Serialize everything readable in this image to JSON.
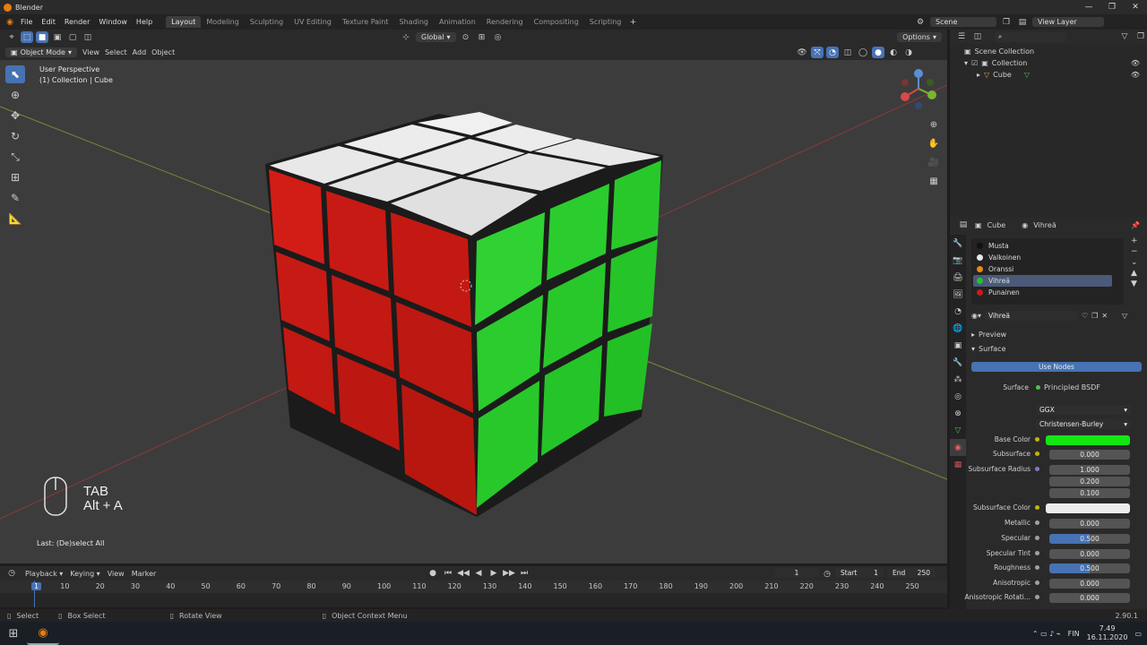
{
  "window": {
    "title": "Blender",
    "controls": [
      "—",
      "❐",
      "✕"
    ]
  },
  "menu": {
    "items": [
      "File",
      "Edit",
      "Render",
      "Window",
      "Help"
    ]
  },
  "workspaces": [
    {
      "label": "Layout",
      "active": true
    },
    {
      "label": "Modeling"
    },
    {
      "label": "Sculpting"
    },
    {
      "label": "UV Editing"
    },
    {
      "label": "Texture Paint"
    },
    {
      "label": "Shading"
    },
    {
      "label": "Animation"
    },
    {
      "label": "Rendering"
    },
    {
      "label": "Compositing"
    },
    {
      "label": "Scripting"
    }
  ],
  "scene": {
    "name": "Scene",
    "view_layer": "View Layer"
  },
  "viewport_toolbar": {
    "orientation": "Global",
    "options": "Options"
  },
  "viewport_header": {
    "mode": "Object Mode",
    "menus": [
      "View",
      "Select",
      "Add",
      "Object"
    ]
  },
  "viewport": {
    "perspective": "User Perspective",
    "collection_info": "(1) Collection | Cube",
    "key_hint_1": "TAB",
    "key_hint_2": "Alt + A",
    "last_op": "Last: (De)select All"
  },
  "timeline": {
    "menus": [
      "Playback",
      "Keying",
      "View",
      "Marker"
    ],
    "current_frame": "1",
    "start_label": "Start",
    "start": "1",
    "end_label": "End",
    "end": "250",
    "ruler_marks": [
      "1",
      "10",
      "20",
      "30",
      "40",
      "50",
      "60",
      "70",
      "80",
      "90",
      "100",
      "110",
      "120",
      "130",
      "140",
      "150",
      "160",
      "170",
      "180",
      "190",
      "200",
      "210",
      "220",
      "230",
      "240",
      "250"
    ]
  },
  "statusbar": {
    "select": "Select",
    "box_select": "Box Select",
    "rotate": "Rotate View",
    "context_menu": "Object Context Menu",
    "version": "2.90.1"
  },
  "taskbar": {
    "lang": "FIN",
    "time": "7.49",
    "date": "16.11.2020"
  },
  "outliner": {
    "root": "Scene Collection",
    "collection": "Collection",
    "object": "Cube"
  },
  "properties": {
    "object": "Cube",
    "material": "Vihreä",
    "material_slots": [
      {
        "name": "Musta",
        "color": "#111111"
      },
      {
        "name": "Valkoinen",
        "color": "#e8e8e8"
      },
      {
        "name": "Oranssi",
        "color": "#e88a1a"
      },
      {
        "name": "Vihreä",
        "color": "#22c22a",
        "active": true
      },
      {
        "name": "Punainen",
        "color": "#d01818"
      }
    ],
    "material_field": "Vihreä",
    "preview_label": "Preview",
    "surface_label": "Surface",
    "use_nodes": "Use Nodes",
    "surface_row_label": "Surface",
    "surface_shader": "Principled BSDF",
    "distribution": "GGX",
    "subsurface_method": "Christensen-Burley",
    "base_color_label": "Base Color",
    "base_color": "#14e614",
    "subsurface_label": "Subsurface",
    "subsurface": "0.000",
    "subsurface_radius_label": "Subsurface Radius",
    "subsurface_radius": [
      "1.000",
      "0.200",
      "0.100"
    ],
    "subsurface_color_label": "Subsurface Color",
    "subsurface_color": "#ececec",
    "metallic_label": "Metallic",
    "metallic": "0.000",
    "specular_label": "Specular",
    "specular": "0.500",
    "specular_tint_label": "Specular Tint",
    "specular_tint": "0.000",
    "roughness_label": "Roughness",
    "roughness": "0.500",
    "anisotropic_label": "Anisotropic",
    "anisotropic": "0.000",
    "anisotropic_rot_label": "Anisotropic Rotati...",
    "anisotropic_rot": "0.000"
  },
  "colors": {
    "accent": "#4772b3",
    "active_tab": "#3d3d3d"
  }
}
